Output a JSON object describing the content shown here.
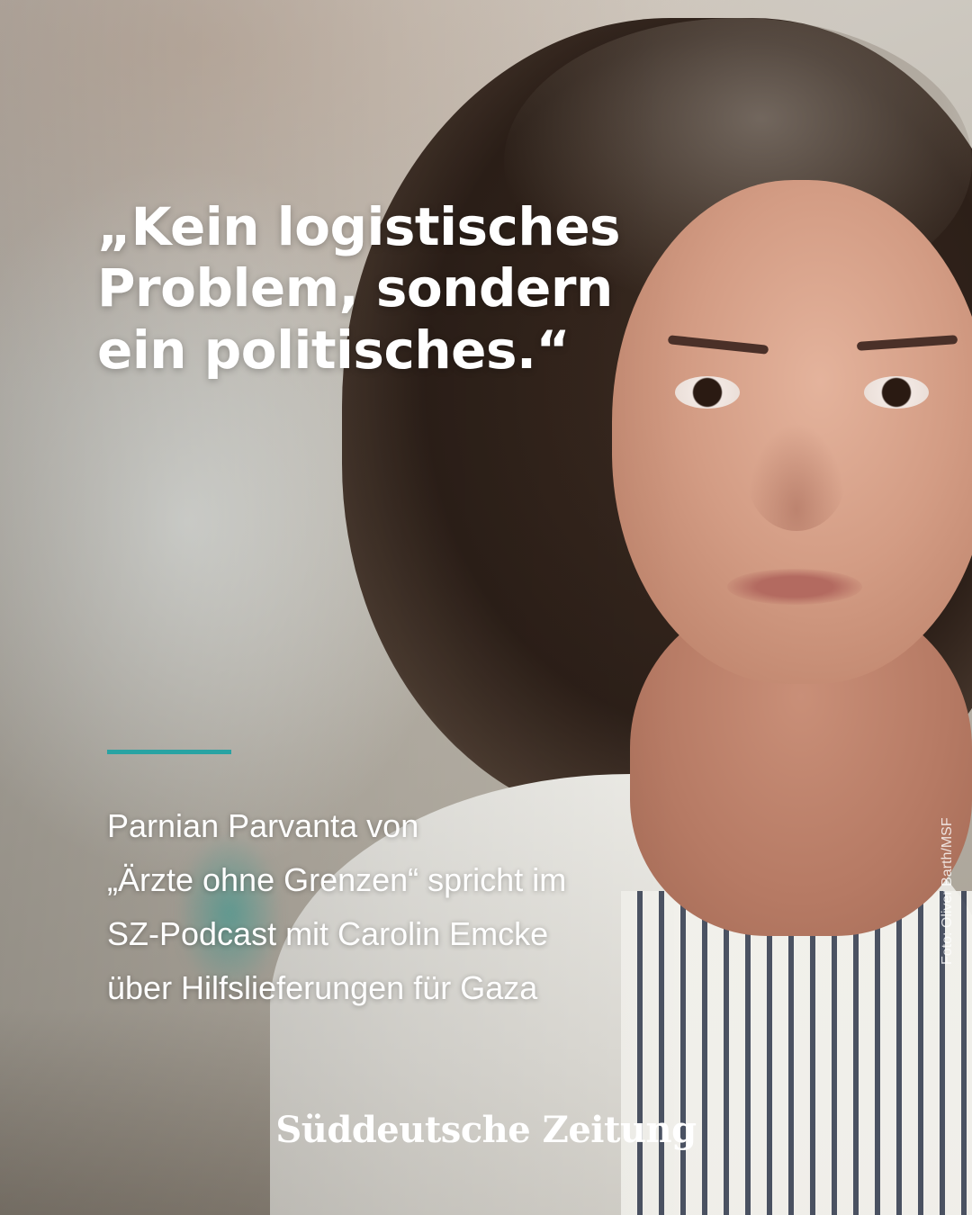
{
  "quote": "„Kein logistisches\nProblem, sondern\nein politisches.“",
  "caption": "Parnian Parvanta von\n„Ärzte ohne Grenzen“ spricht im\nSZ-Podcast mit Carolin Emcke\nüber Hilfslieferungen für Gaza",
  "photo_credit": "Foto: Oliver Barth/MSF",
  "brand_logo": "Süddeutsche Zeitung",
  "colors": {
    "accent": "#29a3a3",
    "text": "#ffffff"
  }
}
